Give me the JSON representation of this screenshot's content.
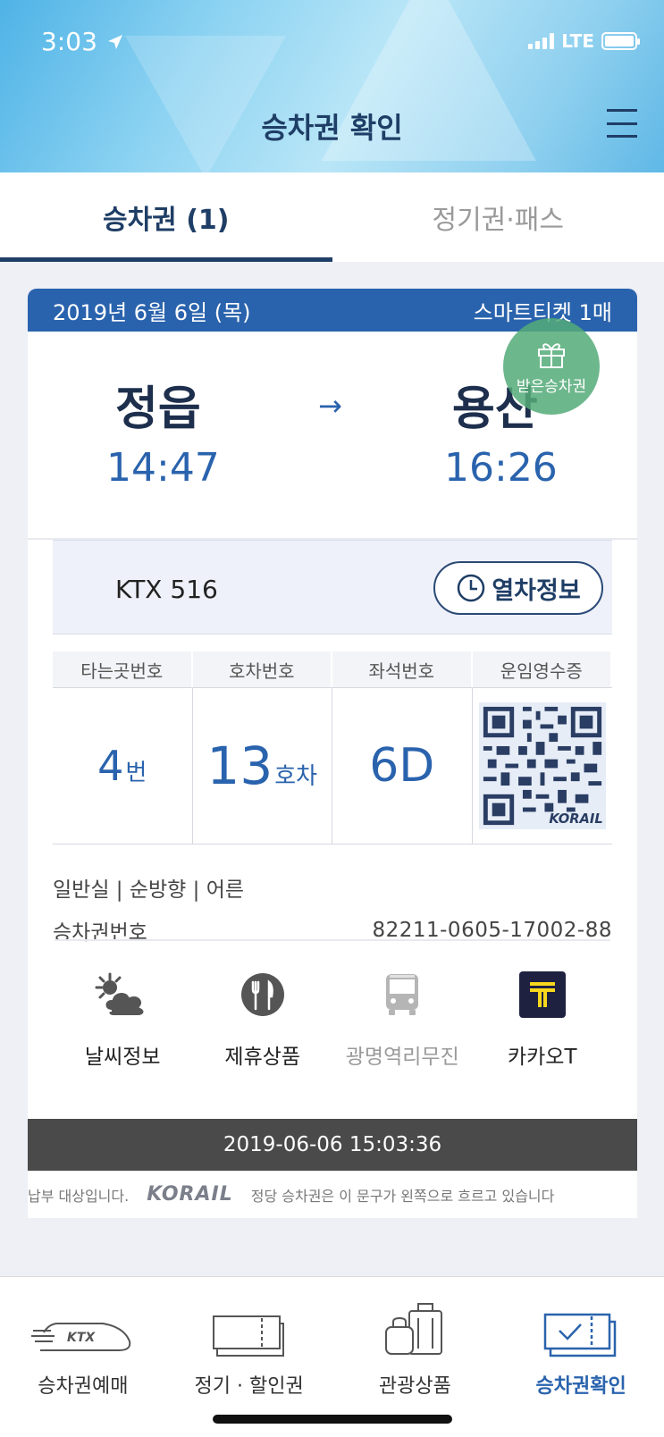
{
  "status_bar": {
    "time": "3:03",
    "network": "LTE"
  },
  "header": {
    "title": "승차권 확인"
  },
  "tabs": [
    {
      "label": "승차권 (1)",
      "active": true
    },
    {
      "label": "정기권·패스",
      "active": false
    }
  ],
  "ticket": {
    "date": "2019년 6월 6일 (목)",
    "ticket_type": "스마트티켓 1매",
    "gift_label": "받은승차권",
    "departure": {
      "station": "정읍",
      "time": "14:47"
    },
    "arrival": {
      "station": "용산",
      "time": "16:26"
    },
    "arrow": "→",
    "train": "KTX 516",
    "train_info_button": "열차정보",
    "columns": [
      "타는곳번호",
      "호차번호",
      "좌석번호",
      "운임영수증"
    ],
    "platform": {
      "value": "4",
      "unit": "번"
    },
    "car": {
      "value": "13",
      "unit": "호차"
    },
    "seat": "6D",
    "qr_brand": "KORAIL",
    "class_info": "일반실 | 순방향 | 어른",
    "ticket_number_label": "승차권번호",
    "ticket_number": "82211-0605-17002-88",
    "services": [
      {
        "label": "날씨정보",
        "icon": "weather-icon",
        "enabled": true
      },
      {
        "label": "제휴상품",
        "icon": "dining-icon",
        "enabled": true
      },
      {
        "label": "광명역리무진",
        "icon": "bus-icon",
        "enabled": false
      },
      {
        "label": "카카오T",
        "icon": "kakao-t-icon",
        "enabled": true
      }
    ],
    "timestamp": "2019-06-06 15:03:36",
    "ticker_left": "납부 대상입니다.",
    "ticker_logo": "KORAIL",
    "ticker_right": "정당 승차권은 이 문구가 왼쪽으로 흐르고 있습니다"
  },
  "nav": [
    {
      "label": "승차권예매",
      "icon": "ktx-train-icon",
      "active": false
    },
    {
      "label": "정기 · 할인권",
      "icon": "ticket-icon",
      "active": false
    },
    {
      "label": "관광상품",
      "icon": "luggage-icon",
      "active": false
    },
    {
      "label": "승차권확인",
      "icon": "ticket-check-icon",
      "active": true
    }
  ],
  "colors": {
    "primary": "#2a63ad",
    "navy": "#1f3e66",
    "gift": "#54aa78",
    "stamp_bg": "#4a4a4a"
  }
}
